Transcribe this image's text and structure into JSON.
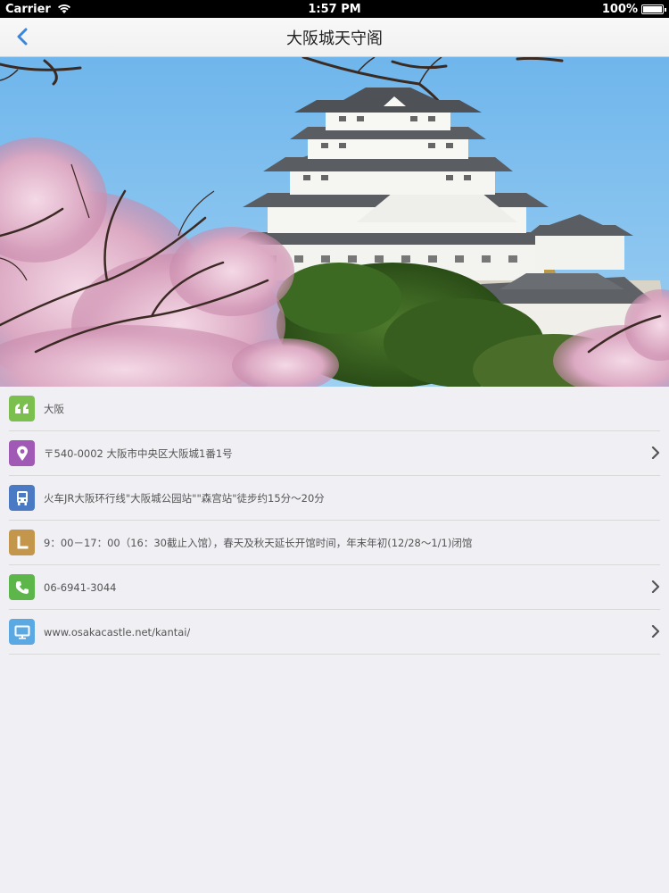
{
  "status_bar": {
    "carrier": "Carrier",
    "time": "1:57 PM",
    "battery": "100%",
    "battery_level": 1.0
  },
  "nav": {
    "title": "大阪城天守阁"
  },
  "colors": {
    "quote": "#7bbf4e",
    "location": "#a05ab5",
    "transit": "#4a7ac3",
    "hours": "#c4964c",
    "phone": "#5cb64a",
    "web": "#5aa9e3"
  },
  "info_rows": [
    {
      "icon": "quote-icon",
      "text": "大阪",
      "has_chevron": false
    },
    {
      "icon": "location-pin-icon",
      "text": "〒540-0002 大阪市中央区大阪城1番1号",
      "has_chevron": true
    },
    {
      "icon": "bus-icon",
      "text": "火车JR大阪环行线\"大阪城公园站\"\"森宫站\"徒步约15分～20分",
      "has_chevron": false
    },
    {
      "icon": "clock-icon",
      "text": "9：00－17：00（16：30截止入馆），春天及秋天延长开馆时间，年末年初(12/28～1/1)闭馆",
      "has_chevron": false
    },
    {
      "icon": "phone-icon",
      "text": "06-6941-3044",
      "has_chevron": true
    },
    {
      "icon": "monitor-icon",
      "text": "www.osakacastle.net/kantai/",
      "has_chevron": true
    }
  ]
}
